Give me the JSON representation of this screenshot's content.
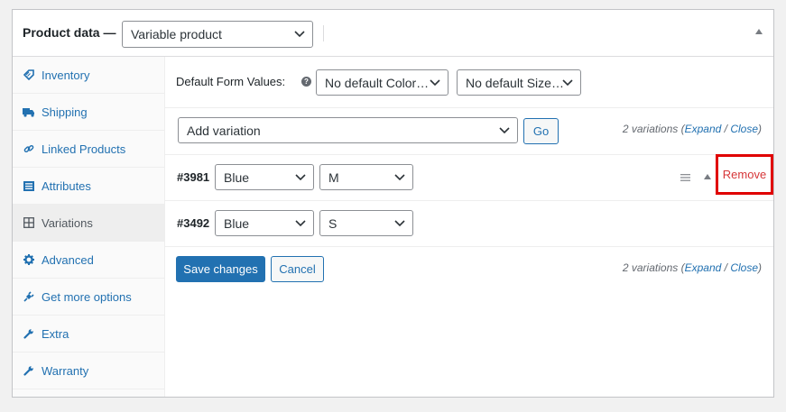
{
  "header": {
    "title": "Product data —",
    "product_type": "Variable product"
  },
  "sidebar": {
    "tabs": [
      {
        "label": "Inventory",
        "icon": "inventory-tag-icon"
      },
      {
        "label": "Shipping",
        "icon": "truck-icon"
      },
      {
        "label": "Linked Products",
        "icon": "link-icon"
      },
      {
        "label": "Attributes",
        "icon": "list-icon"
      },
      {
        "label": "Variations",
        "icon": "grid-icon",
        "active": true
      },
      {
        "label": "Advanced",
        "icon": "gear-icon"
      },
      {
        "label": "Get more options",
        "icon": "plug-icon"
      },
      {
        "label": "Extra",
        "icon": "wrench-icon"
      },
      {
        "label": "Warranty",
        "icon": "wrench-icon"
      }
    ]
  },
  "defaults": {
    "label": "Default Form Values:",
    "help_icon": "?",
    "color_select": "No default Color…",
    "size_select": "No default Size…"
  },
  "toolbar": {
    "action_select": "Add variation",
    "go_label": "Go"
  },
  "variation_count": {
    "count_text": "2 variations",
    "open_paren": "(",
    "expand": "Expand",
    "separator": " / ",
    "close": "Close",
    "close_paren": ")"
  },
  "variations": [
    {
      "id": "#3981",
      "color": "Blue",
      "size": "M",
      "remove_label": "Remove"
    },
    {
      "id": "#3492",
      "color": "Blue",
      "size": "S"
    }
  ],
  "actions": {
    "save_label": "Save changes",
    "cancel_label": "Cancel"
  },
  "colors": {
    "primary": "#2271b1",
    "highlight_box": "#e00000",
    "remove_text": "#d63638"
  }
}
